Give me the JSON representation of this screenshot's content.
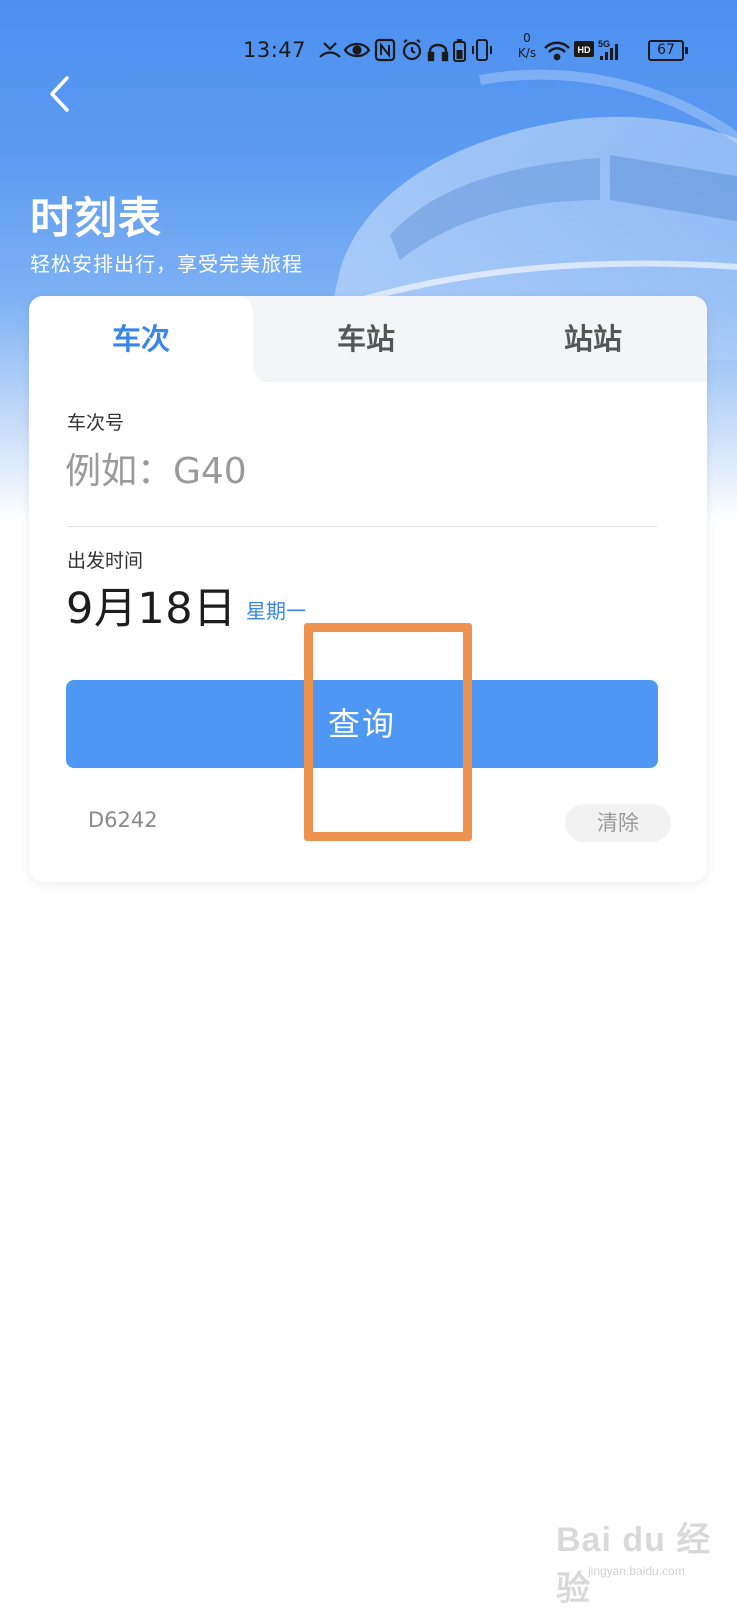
{
  "status_bar": {
    "time": "13:47",
    "speed_value": "0",
    "speed_unit": "K/s",
    "battery": "67",
    "icons": [
      "missed-call-icon",
      "eye-icon",
      "nfc-icon",
      "alarm-icon",
      "headphones-icon",
      "battery-saver-icon",
      "vibrate-icon",
      "wifi-icon",
      "hd-icon",
      "5g-signal-icon"
    ]
  },
  "header": {
    "title": "时刻表",
    "subtitle": "轻松安排出行，享受完美旅程"
  },
  "tabs": [
    {
      "label": "车次",
      "active": true
    },
    {
      "label": "车站",
      "active": false
    },
    {
      "label": "站站",
      "active": false
    }
  ],
  "form": {
    "train_label": "车次号",
    "train_placeholder": "例如：G40",
    "date_label": "出发时间",
    "date_value": "9月18日",
    "weekday": "星期一",
    "query_label": "查询"
  },
  "history": {
    "items": [
      "D6242"
    ],
    "clear_label": "清除"
  },
  "watermark": {
    "text": "Bai du 经验",
    "url": "jingyan.baidu.com"
  },
  "colors": {
    "accent": "#3a86e8",
    "button": "#4e97f2",
    "highlight": "#ee9250"
  }
}
